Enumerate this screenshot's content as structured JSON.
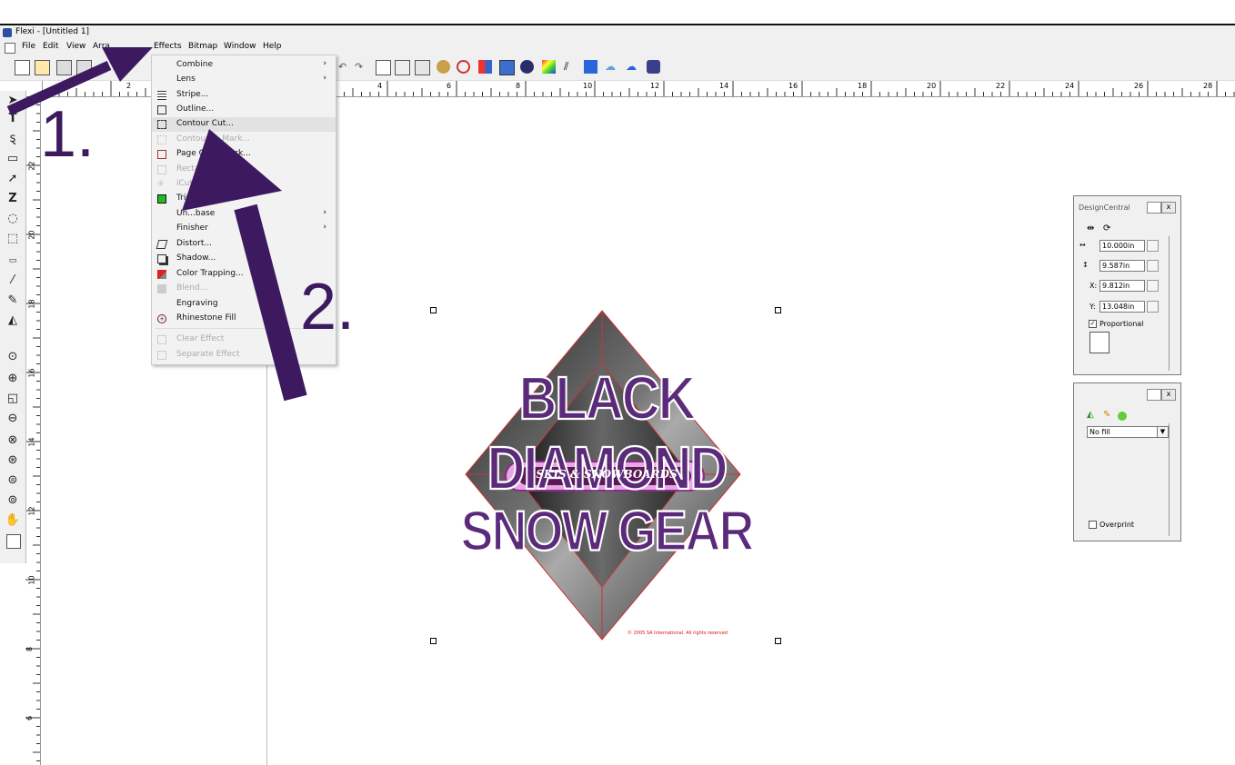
{
  "window": {
    "title": "Flexi - [Untitled 1]"
  },
  "menubar": {
    "items": [
      "File",
      "Edit",
      "View",
      "Arra",
      "Effects",
      "Bitmap",
      "Window",
      "Help"
    ]
  },
  "effects_menu": {
    "items": [
      {
        "label": "Combine",
        "submenu": true,
        "disabled": false
      },
      {
        "label": "Lens",
        "submenu": true,
        "disabled": false
      },
      {
        "label": "Stripe...",
        "submenu": false,
        "disabled": false
      },
      {
        "label": "Outline...",
        "submenu": false,
        "disabled": false
      },
      {
        "label": "Contour Cut...",
        "submenu": false,
        "disabled": false,
        "highlighted": true
      },
      {
        "label": "Contour ... Mark...",
        "submenu": false,
        "disabled": true
      },
      {
        "label": "Page C...... Mark...",
        "submenu": false,
        "disabled": false
      },
      {
        "label": "Rectan... ...t Mark...",
        "submenu": false,
        "disabled": true
      },
      {
        "label": "iCut ...",
        "submenu": false,
        "disabled": true
      },
      {
        "label": "Trim",
        "submenu": false,
        "disabled": false
      },
      {
        "label": "Un...base",
        "submenu": true,
        "disabled": false
      },
      {
        "label": "Finisher",
        "submenu": true,
        "disabled": false
      },
      {
        "label": "Distort...",
        "submenu": false,
        "disabled": false
      },
      {
        "label": "Shadow...",
        "submenu": false,
        "disabled": false
      },
      {
        "label": "Color Trapping...",
        "submenu": false,
        "disabled": false
      },
      {
        "label": "Blend...",
        "submenu": false,
        "disabled": true
      },
      {
        "label": "Engraving",
        "submenu": true,
        "disabled": false
      },
      {
        "label": "Rhinestone Fill",
        "submenu": false,
        "disabled": false
      },
      {
        "label": "Clear Effect",
        "submenu": false,
        "disabled": true
      },
      {
        "label": "Separate Effect",
        "submenu": false,
        "disabled": true
      }
    ]
  },
  "ruler": {
    "h_ticks": [
      "2",
      "4",
      "6",
      "8",
      "10",
      "12",
      "14",
      "16",
      "18",
      "20",
      "22",
      "24",
      "26",
      "28"
    ],
    "v_ticks": [
      "22",
      "20",
      "18",
      "16",
      "14",
      "12",
      "10",
      "8",
      "6"
    ]
  },
  "design_central": {
    "title": "DesignCentral",
    "width": "10.000in",
    "height": "9.587in",
    "x_label": "X:",
    "x": "9.812in",
    "y_label": "Y:",
    "y": "13.048in",
    "proportional_label": "Proportional",
    "proportional_checked": true
  },
  "fill_panel": {
    "fill_value": "No fill",
    "overprint_label": "Overprint",
    "overprint_checked": false
  },
  "artwork": {
    "line1": "BLACK DIAMOND",
    "badge": "SKIS & SNOWBOARDS",
    "line2": "SNOW GEAR",
    "copyright": "© 2005 SA International. All rights reserved"
  },
  "annotations": {
    "step1": "1.",
    "step2": "2.",
    "color": "#3d1a5f"
  }
}
